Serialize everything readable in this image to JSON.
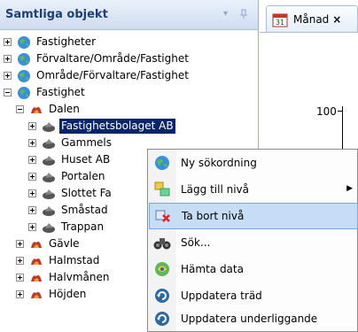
{
  "panel": {
    "title": "Samtliga objekt",
    "pin_glyph": "▾",
    "dock_glyph": "ᵖ"
  },
  "tree": [
    {
      "label": "Fastigheter",
      "icon": "globe-icon"
    },
    {
      "label": "Förvaltare/Område/Fastighet",
      "icon": "globe-icon"
    },
    {
      "label": "Område/Förvaltare/Fastighet",
      "icon": "globe-icon"
    },
    {
      "label": "Fastighet",
      "icon": "globe-icon"
    },
    {
      "label": "Dalen",
      "icon": "area-icon"
    },
    {
      "label": "Fastighetsbolaget AB",
      "icon": "property-icon"
    },
    {
      "label": "Gammels",
      "icon": "property-icon"
    },
    {
      "label": "Huset AB",
      "icon": "property-icon"
    },
    {
      "label": "Portalen",
      "icon": "property-icon"
    },
    {
      "label": "Slottet Fa",
      "icon": "property-icon"
    },
    {
      "label": "Småstad",
      "icon": "property-icon"
    },
    {
      "label": "Trappan",
      "icon": "property-icon"
    },
    {
      "label": "Gävle",
      "icon": "area-icon"
    },
    {
      "label": "Halmstad",
      "icon": "area-icon"
    },
    {
      "label": "Halvmånen",
      "icon": "area-icon"
    },
    {
      "label": "Höjden",
      "icon": "area-icon"
    }
  ],
  "tab": {
    "label": "Månad",
    "close": "×",
    "icon": "calendar-icon"
  },
  "chart": {
    "axis_value": "100"
  },
  "context_menu": [
    {
      "label": "Ny sökordning",
      "icon": "globe-icon"
    },
    {
      "label": "Lägg till nivå",
      "icon": "add-level-icon",
      "submenu": "▶"
    },
    {
      "label": "Ta bort nivå",
      "icon": "remove-level-icon"
    },
    {
      "label": "Sök...",
      "icon": "binoculars-icon"
    },
    {
      "label": "Hämta data",
      "icon": "fetch-data-icon"
    },
    {
      "label": "Uppdatera träd",
      "icon": "refresh-icon"
    },
    {
      "label": "Uppdatera underliggande",
      "icon": "refresh-icon"
    }
  ],
  "colors": {
    "header_text": "#1f3f76",
    "selection": "#0a246a",
    "menu_highlight": "#c7dcf5"
  }
}
